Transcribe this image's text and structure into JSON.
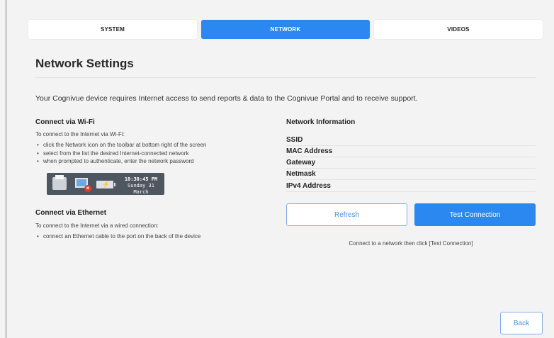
{
  "tabs": [
    {
      "label": "SYSTEM"
    },
    {
      "label": "NETWORK"
    },
    {
      "label": "VIDEOS"
    }
  ],
  "page": {
    "title": "Network Settings",
    "intro": "Your Cognivue device requires Internet access to send reports & data to the Cognivue Portal and to receive support."
  },
  "wifi": {
    "heading": "Connect via Wi-Fi",
    "lead": "To connect to the Internet via Wi-Fi:",
    "steps": [
      "click the Network icon on the toolbar at bottom right of the screen",
      "select from the list the desired Internet-connected network",
      "when prompted to authenticate, enter the network password"
    ],
    "taskbar": {
      "time": "10:30:45 PM",
      "date": "Sunday 31 March"
    }
  },
  "ethernet": {
    "heading": "Connect via Ethernet",
    "lead": "To connect to the Internet via a wired connection:",
    "steps": [
      "connect an Ethernet cable to the port on the back of the device"
    ]
  },
  "network_info": {
    "heading": "Network Information",
    "rows": [
      "SSID",
      "MAC Address",
      "Gateway",
      "Netmask",
      "IPv4 Address"
    ]
  },
  "buttons": {
    "refresh": "Refresh",
    "test": "Test Connection",
    "back": "Back"
  },
  "status_message": "Connect to a network then click [Test Connection]",
  "colors": {
    "accent": "#2b88f0",
    "background": "#f3f3f3"
  }
}
